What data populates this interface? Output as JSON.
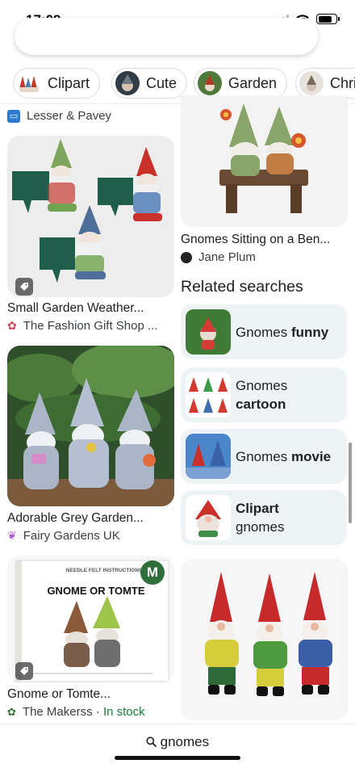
{
  "status": {
    "time": "17:09"
  },
  "search": {
    "placeholder": ""
  },
  "chips": [
    {
      "label": "Clipart",
      "icon": "gnome-clipart-thumb"
    },
    {
      "label": "Cute",
      "icon": "gnome-cute-thumb"
    },
    {
      "label": "Garden",
      "icon": "gnome-garden-thumb"
    },
    {
      "label": "Chri",
      "icon": "gnome-christmas-thumb"
    }
  ],
  "results": {
    "top_source": "Lesser & Pavey",
    "items": [
      {
        "title": "Small Garden Weather...",
        "source": "The Fashion Gift Shop ...",
        "stock": ""
      },
      {
        "title": "Adorable Grey Garden...",
        "source": "Fairy Gardens UK",
        "stock": ""
      },
      {
        "title": "Gnome or Tomte...",
        "source": "The Makerss",
        "separator": " · ",
        "stock": "In stock"
      },
      {
        "title": "Gnomes Sitting on a Ben...",
        "source": "Jane Plum",
        "stock": ""
      }
    ],
    "tomte_card": {
      "header": "NEEDLE FELT INSTRUCTIONS",
      "title": "GNOME OR TOMTE",
      "badge": "M"
    }
  },
  "related": {
    "heading": "Related searches",
    "items": [
      {
        "line1": "Gnomes ",
        "bold1": "funny",
        "line2": "",
        "bold2": ""
      },
      {
        "line1": "Gnomes",
        "bold1": "",
        "line2": "",
        "bold2": "cartoon"
      },
      {
        "line1": "Gnomes ",
        "bold1": "movie",
        "line2": "",
        "bold2": ""
      },
      {
        "line1": "",
        "bold1": "Clipart",
        "line2": "gnomes",
        "bold2": ""
      }
    ]
  },
  "bottom": {
    "query": "gnomes",
    "icon": "search-icon"
  },
  "colors": {
    "accent_green": "#188038",
    "chip_border": "#dadce0",
    "related_bg": "#eef3f6"
  }
}
